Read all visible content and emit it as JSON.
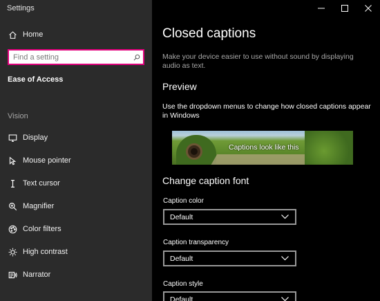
{
  "window": {
    "app_title": "Settings"
  },
  "sidebar": {
    "home_label": "Home",
    "search": {
      "placeholder": "Find a setting",
      "value": ""
    },
    "section_heading": "Ease of Access",
    "group_label": "Vision",
    "items": [
      {
        "label": "Display",
        "icon": "monitor-icon"
      },
      {
        "label": "Mouse pointer",
        "icon": "mouse-pointer-icon"
      },
      {
        "label": "Text cursor",
        "icon": "text-cursor-icon"
      },
      {
        "label": "Magnifier",
        "icon": "magnifier-icon"
      },
      {
        "label": "Color filters",
        "icon": "color-filters-icon"
      },
      {
        "label": "High contrast",
        "icon": "high-contrast-icon"
      },
      {
        "label": "Narrator",
        "icon": "narrator-icon"
      }
    ]
  },
  "main": {
    "title": "Closed captions",
    "description": "Make your device easier to use without sound by displaying audio as text.",
    "preview_heading": "Preview",
    "preview_instructions": "Use the dropdown menus to change how closed captions appear in Windows",
    "preview_caption": "Captions look like this",
    "font_heading": "Change caption font",
    "fields": [
      {
        "label": "Caption color",
        "value": "Default"
      },
      {
        "label": "Caption transparency",
        "value": "Default"
      },
      {
        "label": "Caption style",
        "value": "Default"
      }
    ]
  },
  "colors": {
    "sidebar_bg": "#2b2b2b",
    "main_bg": "#000000",
    "search_focus_border": "#e3007d"
  }
}
